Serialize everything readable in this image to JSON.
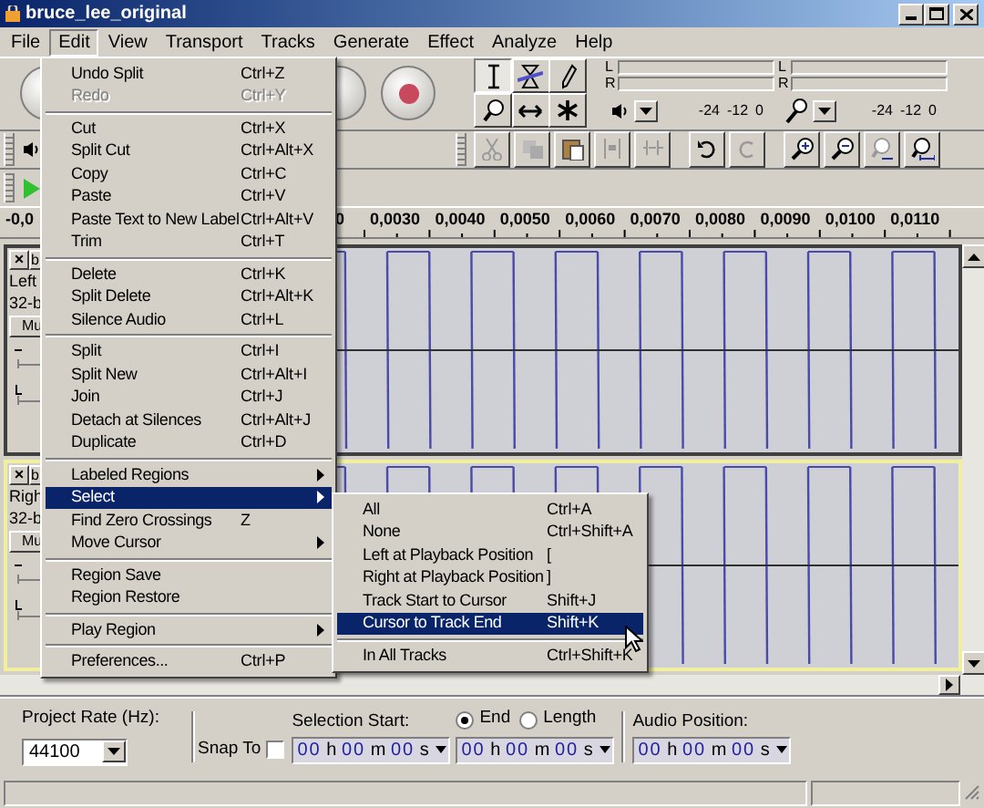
{
  "window": {
    "title": "bruce_lee_original"
  },
  "menu_bar": [
    {
      "label": "File",
      "selected": false
    },
    {
      "label": "Edit",
      "selected": true
    },
    {
      "label": "View",
      "selected": false
    },
    {
      "label": "Transport",
      "selected": false
    },
    {
      "label": "Tracks",
      "selected": false
    },
    {
      "label": "Generate",
      "selected": false
    },
    {
      "label": "Effect",
      "selected": false
    },
    {
      "label": "Analyze",
      "selected": false
    },
    {
      "label": "Help",
      "selected": false
    }
  ],
  "tools": [
    {
      "selected": true
    },
    {
      "selected": false
    },
    {
      "selected": false
    },
    {
      "selected": false
    },
    {
      "selected": false
    },
    {
      "selected": false
    }
  ],
  "meters": [
    {
      "channels": [
        "L",
        "R"
      ],
      "scale": [
        "-24",
        "-12",
        "0"
      ]
    },
    {
      "channels": [
        "L",
        "R"
      ],
      "scale": [
        "-24",
        "-12",
        "0"
      ]
    }
  ],
  "ruler": {
    "labels": [
      "-0,0",
      "0",
      "0,0030",
      "0,0040",
      "0,0050",
      "0,0060",
      "0,0070",
      "0,0080",
      "0,0090",
      "0,0100",
      "0,0110"
    ]
  },
  "tracks": [
    {
      "close": "×",
      "name": "b",
      "lines": [
        "Left",
        "32-b"
      ],
      "mute": "Mu",
      "focused": false
    },
    {
      "close": "×",
      "name": "b",
      "lines": [
        "Righ",
        "32-b"
      ],
      "mute": "Mu",
      "focused": true
    }
  ],
  "edit_menu": [
    {
      "kind": "item",
      "label": "Undo Split",
      "shortcut": "Ctrl+Z",
      "disabled": false,
      "selected": false
    },
    {
      "kind": "item",
      "label": "Redo",
      "shortcut": "Ctrl+Y",
      "disabled": true,
      "selected": false
    },
    {
      "kind": "separator"
    },
    {
      "kind": "item",
      "label": "Cut",
      "shortcut": "Ctrl+X",
      "disabled": false,
      "selected": false
    },
    {
      "kind": "item",
      "label": "Split Cut",
      "shortcut": "Ctrl+Alt+X",
      "disabled": false,
      "selected": false
    },
    {
      "kind": "item",
      "label": "Copy",
      "shortcut": "Ctrl+C",
      "disabled": false,
      "selected": false
    },
    {
      "kind": "item",
      "label": "Paste",
      "shortcut": "Ctrl+V",
      "disabled": false,
      "selected": false
    },
    {
      "kind": "item",
      "label": "Paste Text to New Label",
      "shortcut": "Ctrl+Alt+V",
      "disabled": false,
      "selected": false
    },
    {
      "kind": "item",
      "label": "Trim",
      "shortcut": "Ctrl+T",
      "disabled": false,
      "selected": false
    },
    {
      "kind": "separator"
    },
    {
      "kind": "item",
      "label": "Delete",
      "shortcut": "Ctrl+K",
      "disabled": false,
      "selected": false
    },
    {
      "kind": "item",
      "label": "Split Delete",
      "shortcut": "Ctrl+Alt+K",
      "disabled": false,
      "selected": false
    },
    {
      "kind": "item",
      "label": "Silence Audio",
      "shortcut": "Ctrl+L",
      "disabled": false,
      "selected": false
    },
    {
      "kind": "separator"
    },
    {
      "kind": "item",
      "label": "Split",
      "shortcut": "Ctrl+I",
      "disabled": false,
      "selected": false
    },
    {
      "kind": "item",
      "label": "Split New",
      "shortcut": "Ctrl+Alt+I",
      "disabled": false,
      "selected": false
    },
    {
      "kind": "item",
      "label": "Join",
      "shortcut": "Ctrl+J",
      "disabled": false,
      "selected": false
    },
    {
      "kind": "item",
      "label": "Detach at Silences",
      "shortcut": "Ctrl+Alt+J",
      "disabled": false,
      "selected": false
    },
    {
      "kind": "item",
      "label": "Duplicate",
      "shortcut": "Ctrl+D",
      "disabled": false,
      "selected": false
    },
    {
      "kind": "separator"
    },
    {
      "kind": "submenu",
      "label": "Labeled Regions",
      "disabled": false,
      "selected": false
    },
    {
      "kind": "submenu",
      "label": "Select",
      "disabled": false,
      "selected": true
    },
    {
      "kind": "item",
      "label": "Find Zero Crossings",
      "shortcut": "Z",
      "disabled": false,
      "selected": false
    },
    {
      "kind": "submenu",
      "label": "Move Cursor",
      "disabled": false,
      "selected": false
    },
    {
      "kind": "separator"
    },
    {
      "kind": "item",
      "label": "Region Save",
      "disabled": false,
      "selected": false
    },
    {
      "kind": "item",
      "label": "Region Restore",
      "disabled": false,
      "selected": false
    },
    {
      "kind": "separator"
    },
    {
      "kind": "submenu",
      "label": "Play Region",
      "disabled": false,
      "selected": false
    },
    {
      "kind": "separator"
    },
    {
      "kind": "item",
      "label": "Preferences...",
      "shortcut": "Ctrl+P",
      "disabled": false,
      "selected": false
    }
  ],
  "select_submenu": [
    {
      "kind": "item",
      "label": "All",
      "shortcut": "Ctrl+A",
      "disabled": false,
      "selected": false
    },
    {
      "kind": "item",
      "label": "None",
      "shortcut": "Ctrl+Shift+A",
      "disabled": false,
      "selected": false
    },
    {
      "kind": "item",
      "label": "Left at Playback Position",
      "shortcut": "[",
      "disabled": false,
      "selected": false
    },
    {
      "kind": "item",
      "label": "Right at Playback Position",
      "shortcut": "]",
      "disabled": false,
      "selected": false
    },
    {
      "kind": "item",
      "label": "Track Start to Cursor",
      "shortcut": "Shift+J",
      "disabled": false,
      "selected": false
    },
    {
      "kind": "item",
      "label": "Cursor to Track End",
      "shortcut": "Shift+K",
      "disabled": false,
      "selected": true
    },
    {
      "kind": "separator"
    },
    {
      "kind": "item",
      "label": "In All Tracks",
      "shortcut": "Ctrl+Shift+K",
      "disabled": false,
      "selected": false
    }
  ],
  "selection_toolbar": {
    "project_rate_label": "Project Rate (Hz):",
    "project_rate": "44100",
    "snap_to": {
      "label": "Snap To",
      "checked": false
    },
    "selection_start_label": "Selection Start:",
    "selection_start": "00 h 00 m 00 s",
    "end_length": [
      {
        "label": "End",
        "selected": true
      },
      {
        "label": "Length",
        "selected": false
      }
    ],
    "selection_end": "00 h 00 m 00 s",
    "audio_position_label": "Audio Position:",
    "audio_position": "00 h 00 m 00 s"
  }
}
